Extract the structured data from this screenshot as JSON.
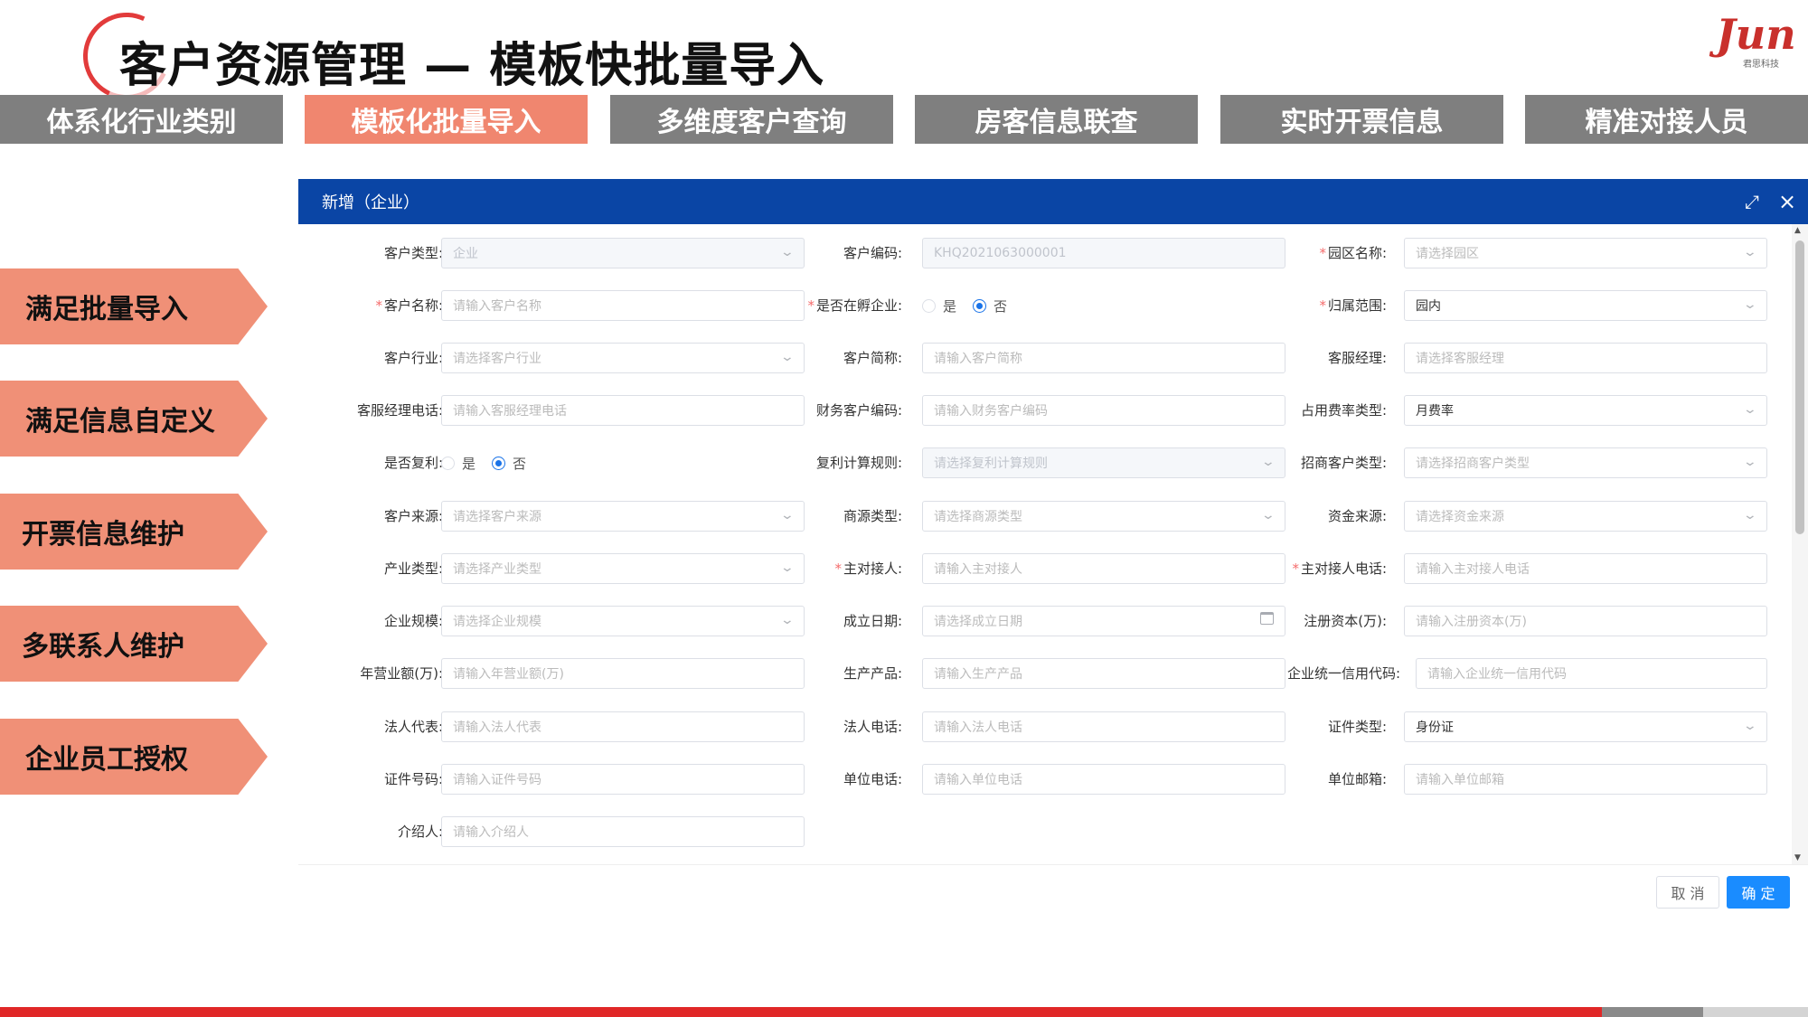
{
  "header": {
    "title": "客户资源管理 — 模板快批量导入",
    "logo_word": "Jun",
    "logo_sub": "君思科技"
  },
  "top_tabs": [
    {
      "label": "体系化行业类别",
      "active": false
    },
    {
      "label": "模板化批量导入",
      "active": true
    },
    {
      "label": "多维度客户查询",
      "active": false
    },
    {
      "label": "房客信息联查",
      "active": false
    },
    {
      "label": "实时开票信息",
      "active": false
    },
    {
      "label": "精准对接人员",
      "active": false
    }
  ],
  "side_features": [
    "满足批量导入",
    "满足信息自定义",
    "开票信息维护",
    "多联系人维护",
    "企业员工授权"
  ],
  "dialog": {
    "title": "新增（企业）",
    "fields": {
      "customer_type": {
        "label": "客户类型:",
        "value": "企业"
      },
      "customer_code": {
        "label": "客户编码:",
        "value": "KHQ2021063000001"
      },
      "park_name": {
        "label": "园区名称:",
        "placeholder": "请选择园区"
      },
      "customer_name": {
        "label": "客户名称:",
        "placeholder": "请输入客户名称"
      },
      "incubating": {
        "label": "是否在孵企业:",
        "yes": "是",
        "no": "否"
      },
      "scope": {
        "label": "归属范围:",
        "value": "园内"
      },
      "industry": {
        "label": "客户行业:",
        "placeholder": "请选择客户行业"
      },
      "short_name": {
        "label": "客户简称:",
        "placeholder": "请输入客户简称"
      },
      "service_manager": {
        "label": "客服经理:",
        "placeholder": "请选择客服经理"
      },
      "manager_phone": {
        "label": "客服经理电话:",
        "placeholder": "请输入客服经理电话"
      },
      "finance_code": {
        "label": "财务客户编码:",
        "placeholder": "请输入财务客户编码"
      },
      "fee_rate_type": {
        "label": "占用费率类型:",
        "value": "月费率"
      },
      "compound": {
        "label": "是否复利:",
        "yes": "是",
        "no": "否"
      },
      "compound_rule": {
        "label": "复利计算规则:",
        "placeholder": "请选择复利计算规则"
      },
      "merchant_type": {
        "label": "招商客户类型:",
        "placeholder": "请选择招商客户类型"
      },
      "source": {
        "label": "客户来源:",
        "placeholder": "请选择客户来源"
      },
      "business_source_type": {
        "label": "商源类型:",
        "placeholder": "请选择商源类型"
      },
      "funding_source": {
        "label": "资金来源:",
        "placeholder": "请选择资金来源"
      },
      "industry_type": {
        "label": "产业类型:",
        "placeholder": "请选择产业类型"
      },
      "main_contact": {
        "label": "主对接人:",
        "placeholder": "请输入主对接人"
      },
      "main_contact_phone": {
        "label": "主对接人电话:",
        "placeholder": "请输入主对接人电话"
      },
      "scale": {
        "label": "企业规模:",
        "placeholder": "请选择企业规模"
      },
      "founded": {
        "label": "成立日期:",
        "placeholder": "请选择成立日期"
      },
      "registered_capital": {
        "label": "注册资本(万):",
        "placeholder": "请输入注册资本(万)"
      },
      "revenue": {
        "label": "年营业额(万):",
        "placeholder": "请输入年营业额(万)"
      },
      "products": {
        "label": "生产产品:",
        "placeholder": "请输入生产产品"
      },
      "credit_code": {
        "label": "企业统一信用代码:",
        "placeholder": "请输入企业统一信用代码"
      },
      "legal_rep": {
        "label": "法人代表:",
        "placeholder": "请输入法人代表"
      },
      "legal_phone": {
        "label": "法人电话:",
        "placeholder": "请输入法人电话"
      },
      "id_type": {
        "label": "证件类型:",
        "value": "身份证"
      },
      "id_number": {
        "label": "证件号码:",
        "placeholder": "请输入证件号码"
      },
      "company_phone": {
        "label": "单位电话:",
        "placeholder": "请输入单位电话"
      },
      "company_email": {
        "label": "单位邮箱:",
        "placeholder": "请输入单位邮箱"
      },
      "referrer": {
        "label": "介绍人:",
        "placeholder": "请输入介绍人"
      }
    },
    "cancel_label": "取 消",
    "ok_label": "确 定"
  }
}
